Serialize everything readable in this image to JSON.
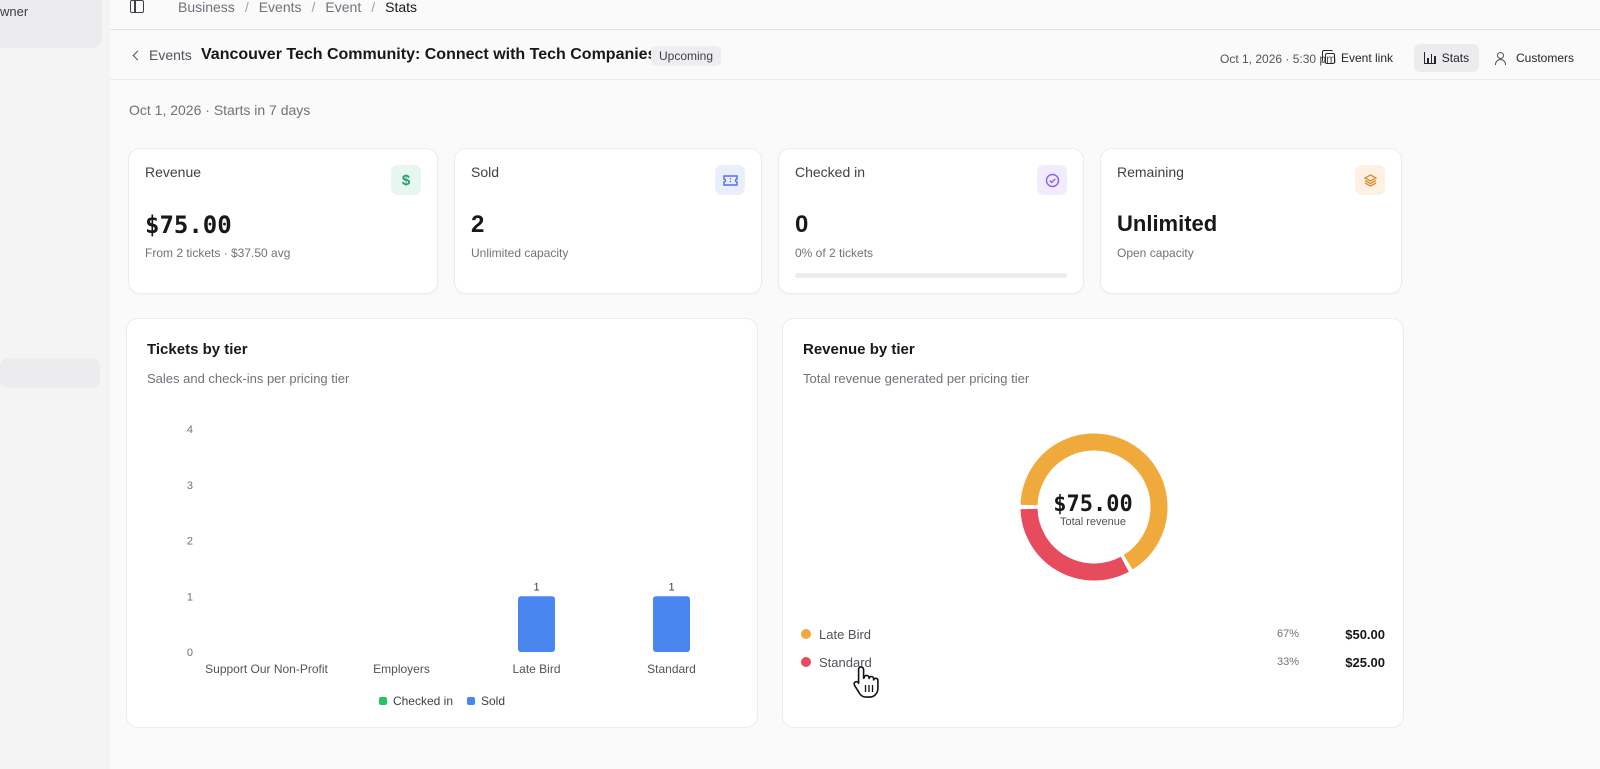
{
  "sidebar": {
    "owner_fragment": "wner"
  },
  "breadcrumb": [
    "Business",
    "Events",
    "Event",
    "Stats"
  ],
  "header": {
    "back_label": "Events",
    "title": "Vancouver Tech Community: Connect with Tech Companies",
    "status": "Upcoming",
    "date": "Oct 1, 2026 · 5:30 pm",
    "buttons": {
      "event_link": "Event link",
      "stats": "Stats",
      "customers": "Customers"
    }
  },
  "date_line": "Oct 1, 2026 · Starts in 7 days",
  "stats": {
    "revenue": {
      "label": "Revenue",
      "value": "$75.00",
      "sub": "From 2 tickets · $37.50 avg",
      "icon": "dollar-icon",
      "icon_color": "#22a06b",
      "icon_bg": "#e7f6ee"
    },
    "sold": {
      "label": "Sold",
      "value": "2",
      "sub": "Unlimited capacity",
      "icon": "ticket-icon",
      "icon_color": "#4f6fe6",
      "icon_bg": "#eaeefd"
    },
    "checked_in": {
      "label": "Checked in",
      "value": "0",
      "sub": "0% of 2 tickets",
      "progress": 0,
      "icon": "check-circle-icon",
      "icon_color": "#8b5cf6",
      "icon_bg": "#f1ebfe"
    },
    "remaining": {
      "label": "Remaining",
      "value": "Unlimited",
      "sub": "Open capacity",
      "icon": "layers-icon",
      "icon_color": "#e08a2e",
      "icon_bg": "#fdf1e4"
    }
  },
  "tickets_card": {
    "title": "Tickets by tier",
    "subtitle": "Sales and check-ins per pricing tier"
  },
  "revenue_card": {
    "title": "Revenue by tier",
    "subtitle": "Total revenue generated per pricing tier",
    "total_value": "$75.00",
    "total_label": "Total revenue",
    "tiers": [
      {
        "name": "Late Bird",
        "pct": "67%",
        "amount": "$50.00",
        "color": "#f0a93b"
      },
      {
        "name": "Standard",
        "pct": "33%",
        "amount": "$25.00",
        "color": "#e64c5e"
      }
    ]
  },
  "chart_data": [
    {
      "type": "bar",
      "title": "Tickets by tier",
      "categories": [
        "Support Our Non-Profit",
        "Employers",
        "Late Bird",
        "Standard"
      ],
      "series": [
        {
          "name": "Checked in",
          "values": [
            0,
            0,
            0,
            0
          ],
          "color": "#22c55e"
        },
        {
          "name": "Sold",
          "values": [
            0,
            0,
            1,
            1
          ],
          "color": "#4a86f0"
        }
      ],
      "ylim": [
        0,
        4
      ],
      "yticks": [
        0,
        1,
        2,
        3,
        4
      ],
      "legend": "bottom"
    },
    {
      "type": "pie",
      "title": "Revenue by tier",
      "labels": [
        "Late Bird",
        "Standard"
      ],
      "values": [
        50,
        25
      ],
      "colors": [
        "#f0a93b",
        "#e64c5e"
      ]
    }
  ]
}
